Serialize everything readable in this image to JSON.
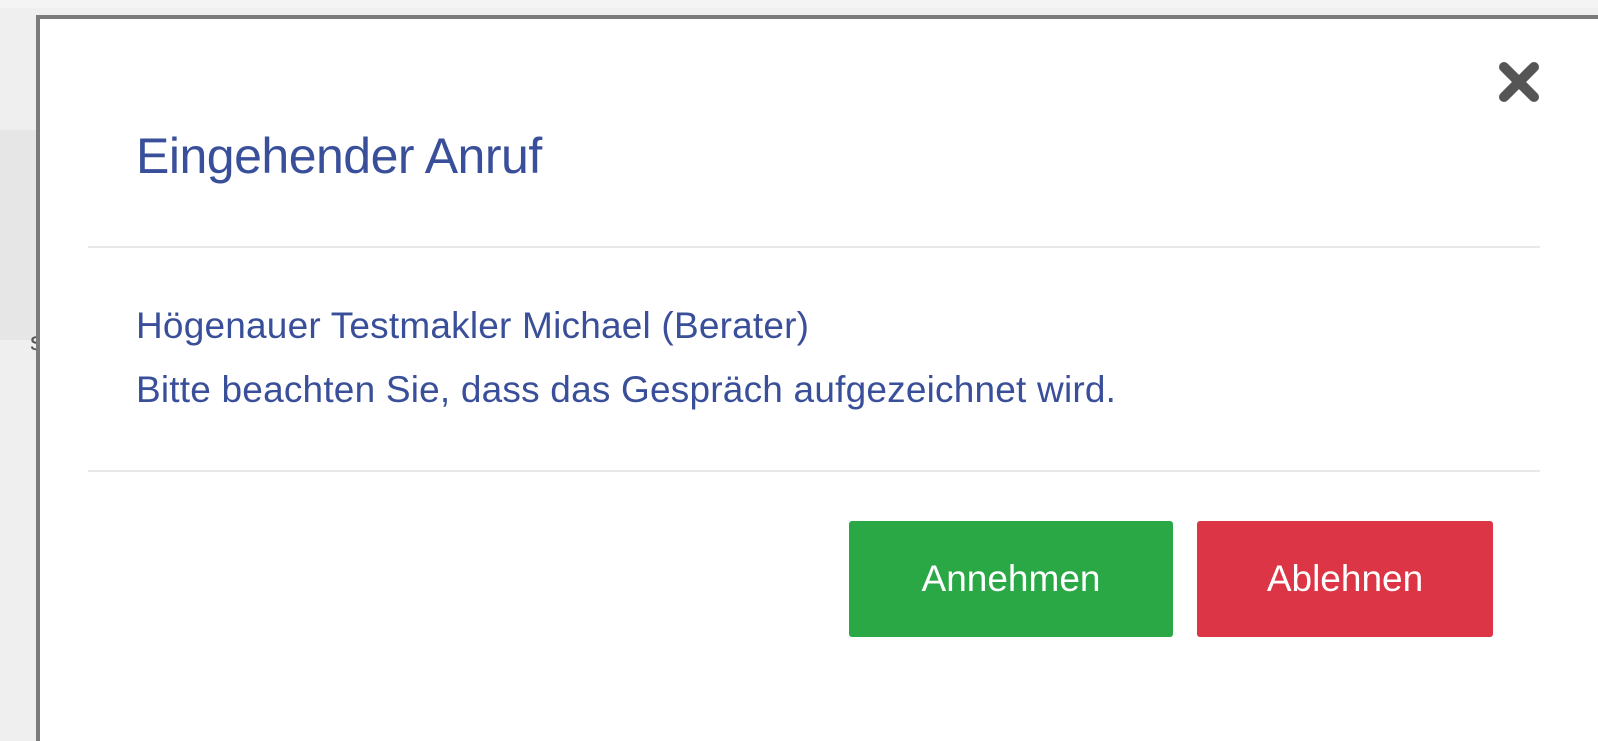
{
  "dialog": {
    "title": "Eingehender Anruf",
    "caller": "Högenauer Testmakler Michael (Berater)",
    "notice": "Bitte beachten Sie, dass das Gespräch aufgezeichnet wird.",
    "close_icon": "close-icon"
  },
  "actions": {
    "accept_label": "Annehmen",
    "decline_label": "Ablehnen"
  },
  "colors": {
    "text": "#3a4f9a",
    "accept": "#2aa846",
    "decline": "#dc3545",
    "close_icon": "#555555"
  }
}
